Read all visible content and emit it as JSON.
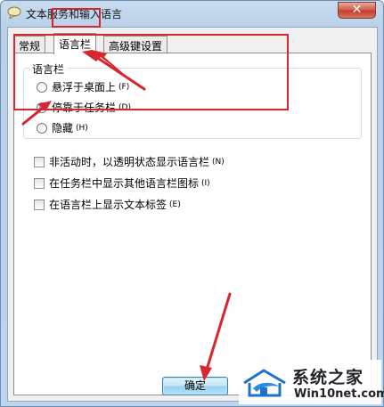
{
  "window": {
    "title": "文本服务和输入语言",
    "close_label": "✕"
  },
  "tabs": [
    {
      "label": "常规",
      "active": false
    },
    {
      "label": "语言栏",
      "active": true
    },
    {
      "label": "高级键设置",
      "active": false
    }
  ],
  "language_bar_group": {
    "title": "语言栏",
    "options": [
      {
        "label": "悬浮于桌面上",
        "hotkey": "(F)",
        "selected": false
      },
      {
        "label": "停靠于任务栏",
        "hotkey": "(D)",
        "selected": true
      },
      {
        "label": "隐藏",
        "hotkey": "(H)",
        "selected": false
      }
    ]
  },
  "checkboxes": [
    {
      "label": "非活动时，以透明状态显示语言栏",
      "hotkey": "(N)",
      "checked": false
    },
    {
      "label": "在任务栏中显示其他语言栏图标",
      "hotkey": "(I)",
      "checked": false
    },
    {
      "label": "在语言栏上显示文本标签",
      "hotkey": "(E)",
      "checked": false
    }
  ],
  "footer": {
    "ok_label": "确定"
  },
  "watermark": {
    "name": "系统之家",
    "url": "Win10net.com"
  },
  "colors": {
    "annotation_red": "#d7262d",
    "titlebar": "#c9dcef",
    "ok_button_border": "#3c7fb1"
  },
  "icons": {
    "app": "speech-bubble-icon",
    "close": "close-icon",
    "watermark_logo": "house-logo-icon"
  }
}
